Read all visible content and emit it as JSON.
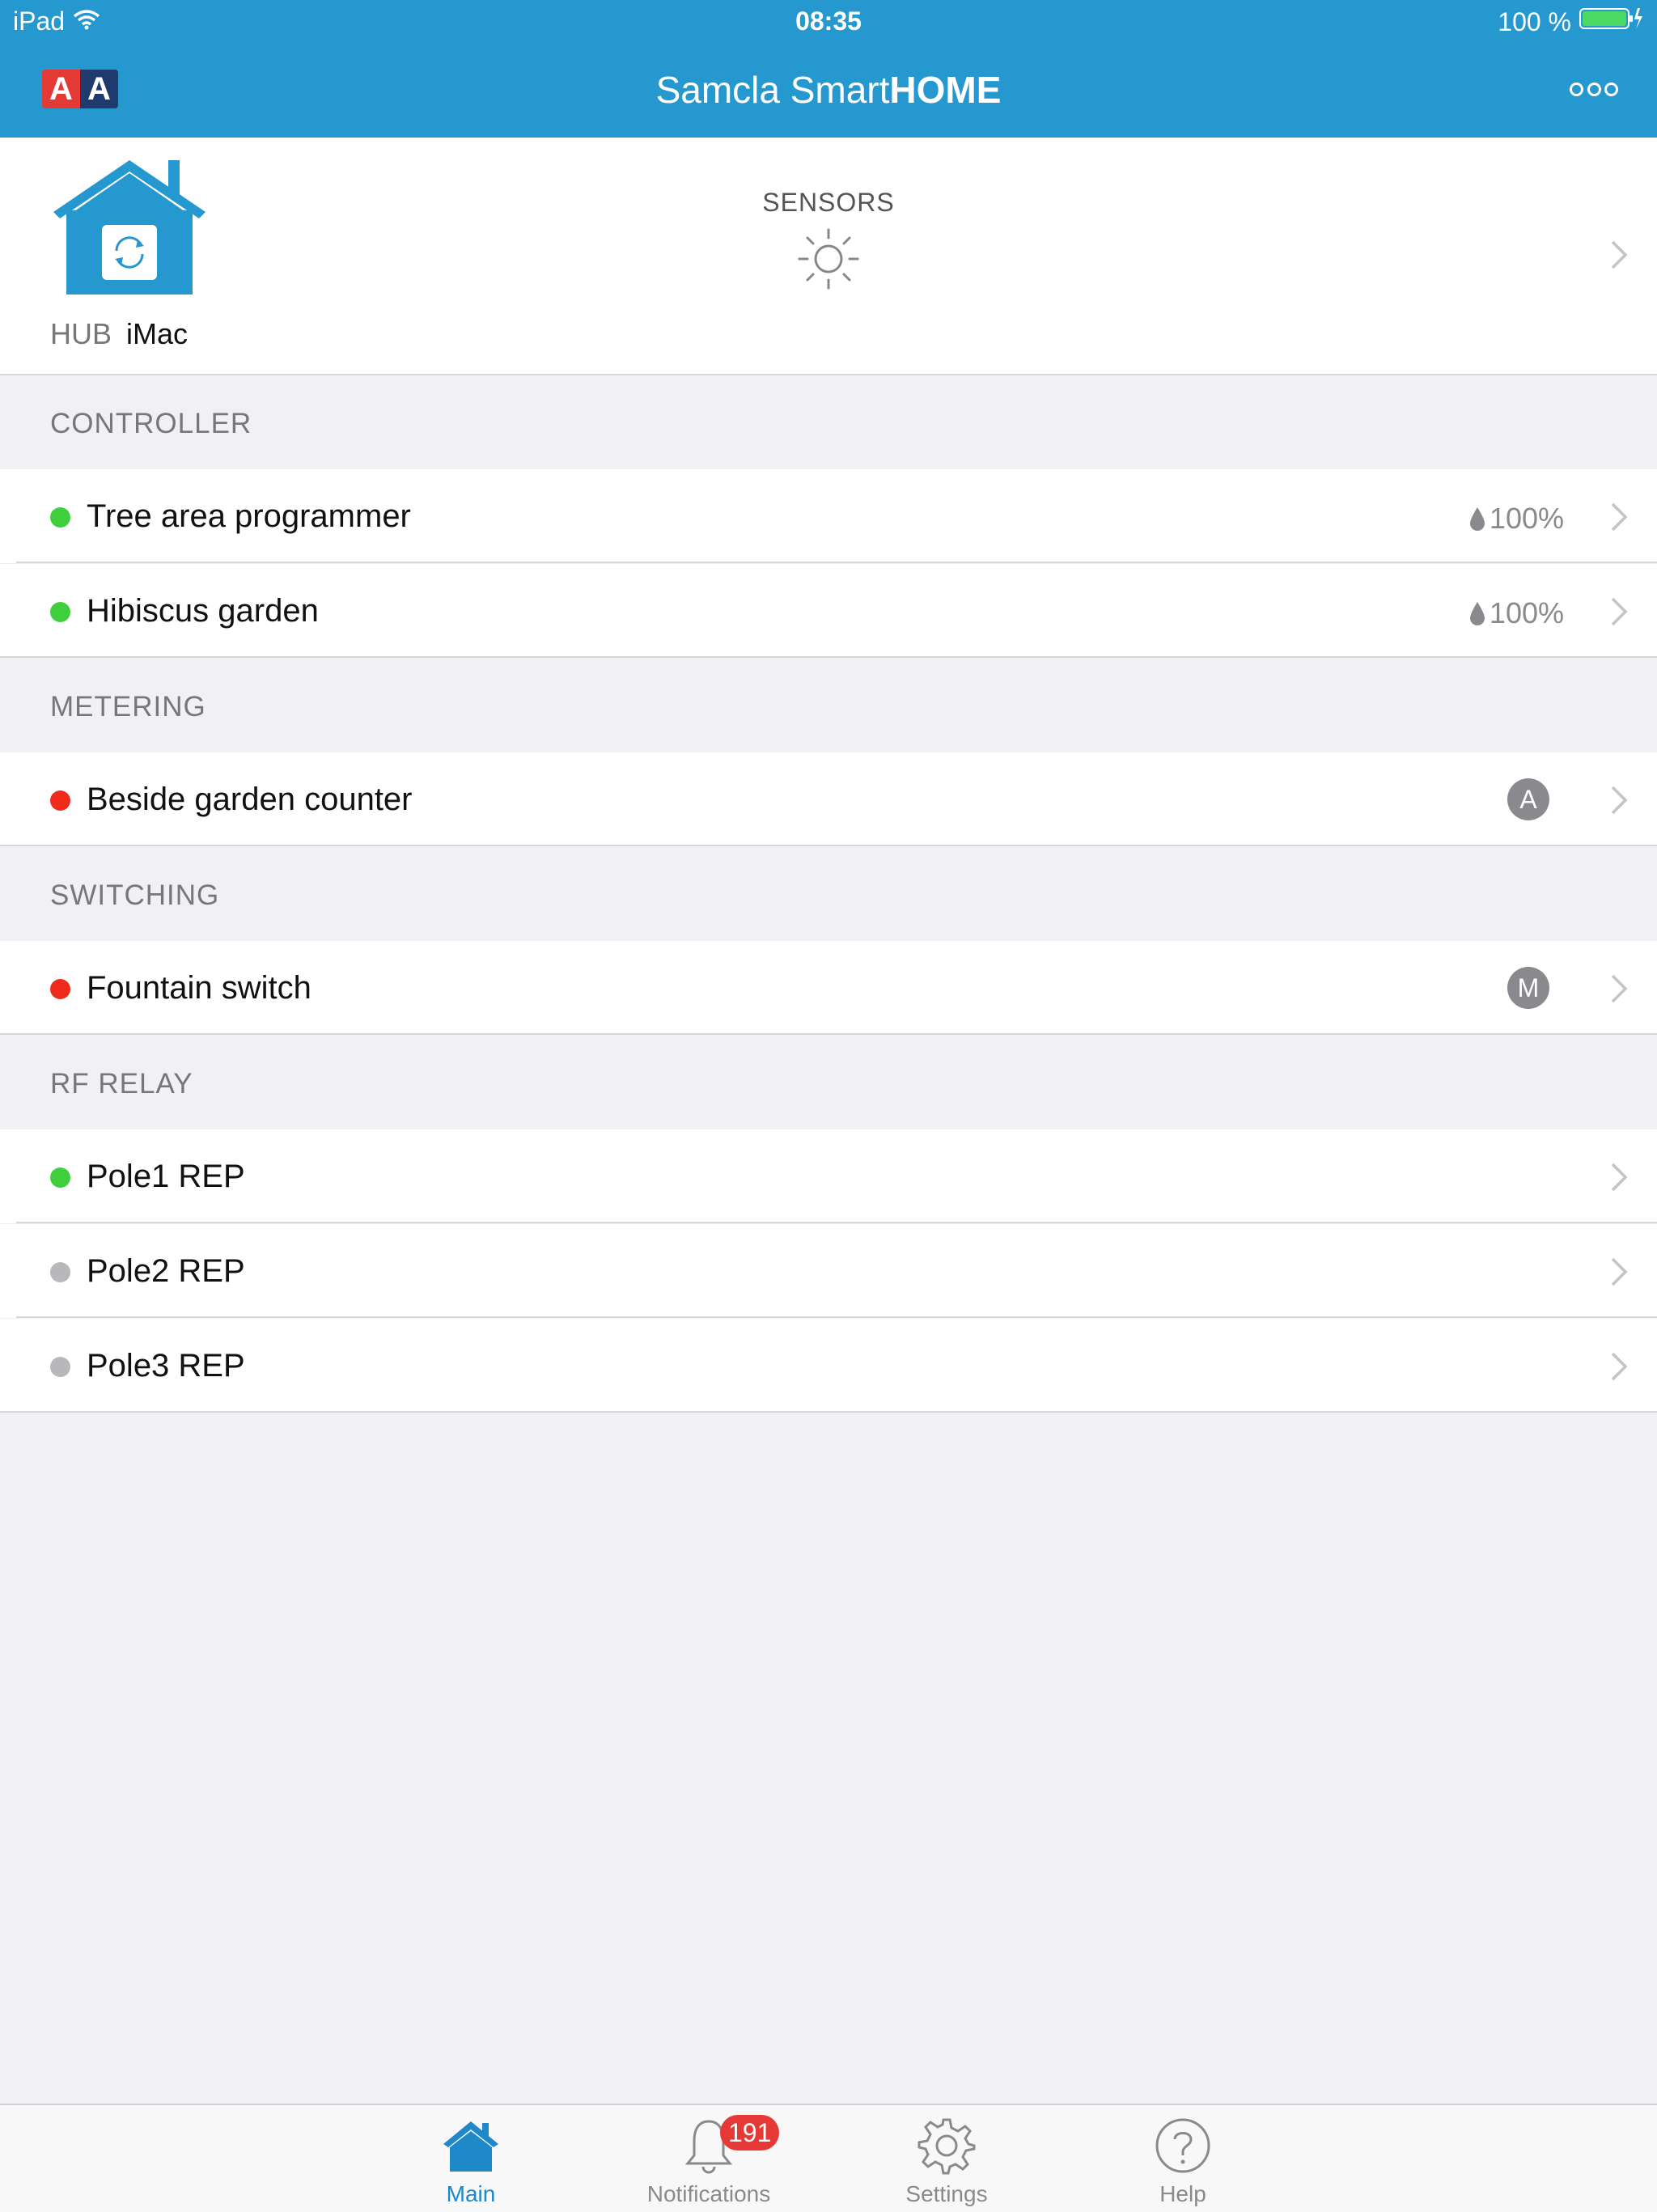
{
  "status_bar": {
    "carrier": "iPad",
    "time": "08:35",
    "battery_text": "100 %",
    "battery_level": 1.0
  },
  "header": {
    "logo_letters": [
      "A",
      "A"
    ],
    "title_regular": "Samcla Smart",
    "title_bold": "HOME",
    "more_icon": "ellipsis-icon"
  },
  "hub": {
    "label_key": "HUB",
    "label_value": "iMac",
    "sensors_label": "SENSORS"
  },
  "sections": [
    {
      "title": "CONTROLLER",
      "items": [
        {
          "name": "Tree area programmer",
          "status": "green",
          "level": "100%"
        },
        {
          "name": "Hibiscus garden",
          "status": "green",
          "level": "100%"
        }
      ]
    },
    {
      "title": "METERING",
      "items": [
        {
          "name": "Beside garden counter",
          "status": "red",
          "badge": "A"
        }
      ]
    },
    {
      "title": "SWITCHING",
      "items": [
        {
          "name": "Fountain switch",
          "status": "red",
          "badge": "M"
        }
      ]
    },
    {
      "title": "RF RELAY",
      "items": [
        {
          "name": "Pole1 REP",
          "status": "green"
        },
        {
          "name": "Pole2 REP",
          "status": "gray"
        },
        {
          "name": "Pole3 REP",
          "status": "gray"
        }
      ]
    }
  ],
  "tabs": [
    {
      "label": "Main",
      "icon": "home-icon",
      "active": true
    },
    {
      "label": "Notifications",
      "icon": "bell-icon",
      "badge": "191"
    },
    {
      "label": "Settings",
      "icon": "gear-icon"
    },
    {
      "label": "Help",
      "icon": "help-icon"
    }
  ],
  "colors": {
    "accent": "#2698d0",
    "status_green": "#3fcf3c",
    "status_red": "#f02b1b",
    "status_gray": "#b8b8bc",
    "tab_active": "#1e88c8"
  }
}
